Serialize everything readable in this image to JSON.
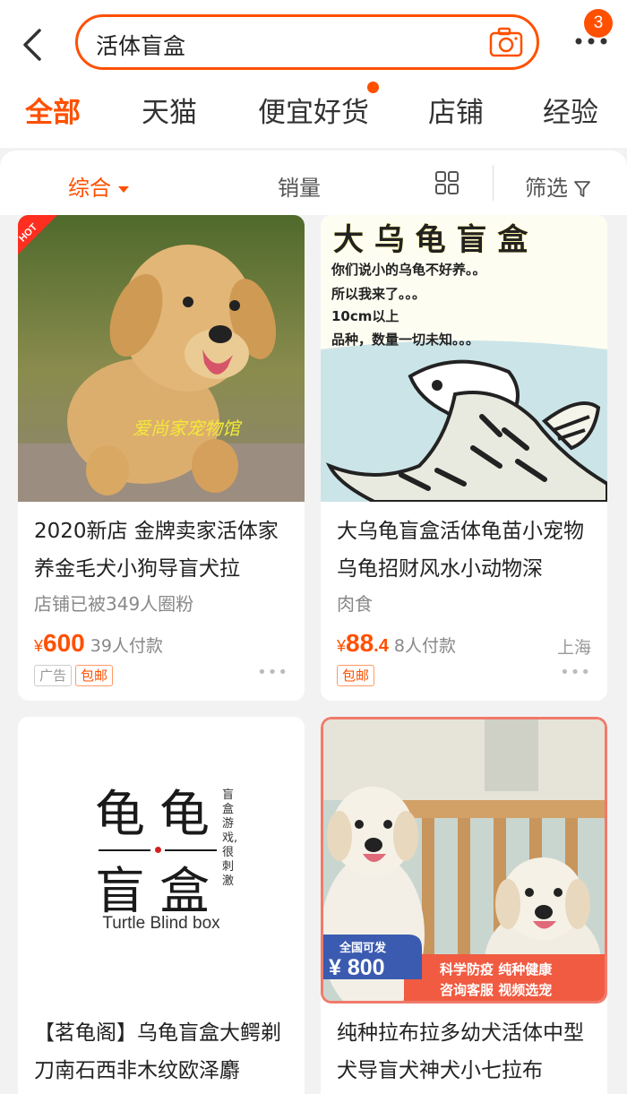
{
  "search": {
    "query": "活体盲盒"
  },
  "header": {
    "more_badge": "3"
  },
  "tabs": [
    {
      "label": "全部"
    },
    {
      "label": "天猫"
    },
    {
      "label": "便宜好货"
    },
    {
      "label": "店铺"
    },
    {
      "label": "经验"
    }
  ],
  "sort": {
    "comprehensive": "综合",
    "sales": "销量",
    "filter": "筛选"
  },
  "products": [
    {
      "title": "2020新店 金牌卖家活体家养金毛犬小狗导盲犬拉",
      "subtitle": "店铺已被349人圈粉",
      "currency": "¥",
      "price": "600",
      "paid": "39人付款",
      "location": "",
      "tags": [
        "广告",
        "包邮"
      ],
      "image": {
        "hot_label": "HOT",
        "watermark": "爱尚家宠物馆"
      }
    },
    {
      "title": "大乌龟盲盒活体龟苗小宠物乌龟招财风水小动物深",
      "subtitle": "肉食",
      "currency": "¥",
      "price": "88",
      "price_decimal": ".4",
      "paid": "8人付款",
      "location": "上海",
      "tags": [
        "包邮"
      ],
      "image": {
        "headline": "大 乌 龟 盲 盒",
        "lines": [
          "你们说小的乌龟不好养。。",
          "所以我来了。。。",
          "10cm以上",
          "品种，数量一切未知。。。"
        ]
      }
    },
    {
      "title": "【茗龟阁】乌龟盲盒大鳄剃刀南石西非木纹欧泽麝",
      "subtitle": "",
      "image": {
        "big_chars": [
          "龟",
          "龟",
          "盲",
          "盒"
        ],
        "side_text": "盲盒游戏,很刺激",
        "english": "Turtle Blind box"
      }
    },
    {
      "title": "纯种拉布拉多幼犬活体中型犬导盲犬神犬小七拉布",
      "subtitle": "",
      "image": {
        "badge_top": "全国可发",
        "badge_price": "¥ 800",
        "banner_line1": "科学防疫  纯种健康",
        "banner_line2": "咨询客服  视频选宠"
      }
    }
  ]
}
